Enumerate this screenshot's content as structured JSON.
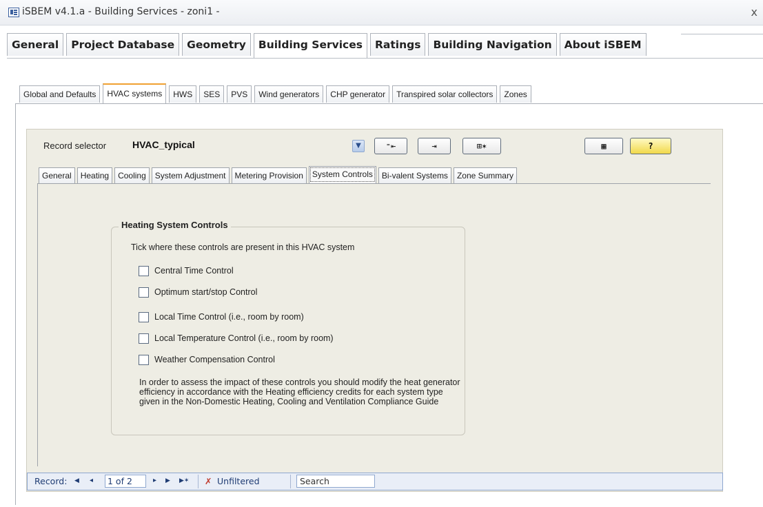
{
  "window": {
    "title": "iSBEM v4.1.a - Building Services - zoni1 -",
    "close_icon": "close-icon"
  },
  "main_tabs": [
    {
      "label": "General"
    },
    {
      "label": "Project Database"
    },
    {
      "label": "Geometry"
    },
    {
      "label": "Building Services",
      "active": true
    },
    {
      "label": "Ratings"
    },
    {
      "label": "Building Navigation"
    },
    {
      "label": "About iSBEM"
    }
  ],
  "sub_tabs": [
    {
      "label": "Global and Defaults"
    },
    {
      "label": "HVAC systems",
      "active": true
    },
    {
      "label": "HWS"
    },
    {
      "label": "SES"
    },
    {
      "label": "PVS"
    },
    {
      "label": "Wind generators"
    },
    {
      "label": "CHP generator"
    },
    {
      "label": "Transpired solar collectors"
    },
    {
      "label": "Zones"
    }
  ],
  "record_selector": {
    "label": "Record selector",
    "value": "HVAC_typical",
    "dropdown_icon": "▼"
  },
  "toolbar": {
    "btn1": "⁼⇤",
    "btn2": "⇥",
    "btn3": "⊞✶",
    "btn4": "▦",
    "btn5": "?"
  },
  "form_tabs": [
    {
      "label": "General"
    },
    {
      "label": "Heating"
    },
    {
      "label": "Cooling"
    },
    {
      "label": "System Adjustment"
    },
    {
      "label": "Metering Provision"
    },
    {
      "label": "System Controls",
      "active": true
    },
    {
      "label": "Bi-valent Systems"
    },
    {
      "label": "Zone Summary"
    }
  ],
  "heating_controls": {
    "title": "Heating System Controls",
    "instruction": "Tick where these controls are present in this HVAC system",
    "options": [
      {
        "label": "Central Time Control",
        "checked": false
      },
      {
        "label": "Optimum start/stop Control",
        "checked": false
      },
      {
        "label": "Local Time Control (i.e., room by room)",
        "checked": false
      },
      {
        "label": "Local Temperature Control (i.e., room by room)",
        "checked": false
      },
      {
        "label": "Weather Compensation Control",
        "checked": false
      }
    ],
    "note": "In order to assess the impact of these controls you should modify the heat generator efficiency in accordance with the Heating efficiency credits for each system type given in the Non-Domestic Heating, Cooling and Ventilation Compliance Guide"
  },
  "nav": {
    "record_label": "Record:",
    "first": "◀",
    "prev": "◂",
    "current": "1 of 2",
    "next": "▸",
    "last": "▶",
    "new": "▶✶",
    "filter_label": "Unfiltered",
    "search_label": "Search"
  }
}
